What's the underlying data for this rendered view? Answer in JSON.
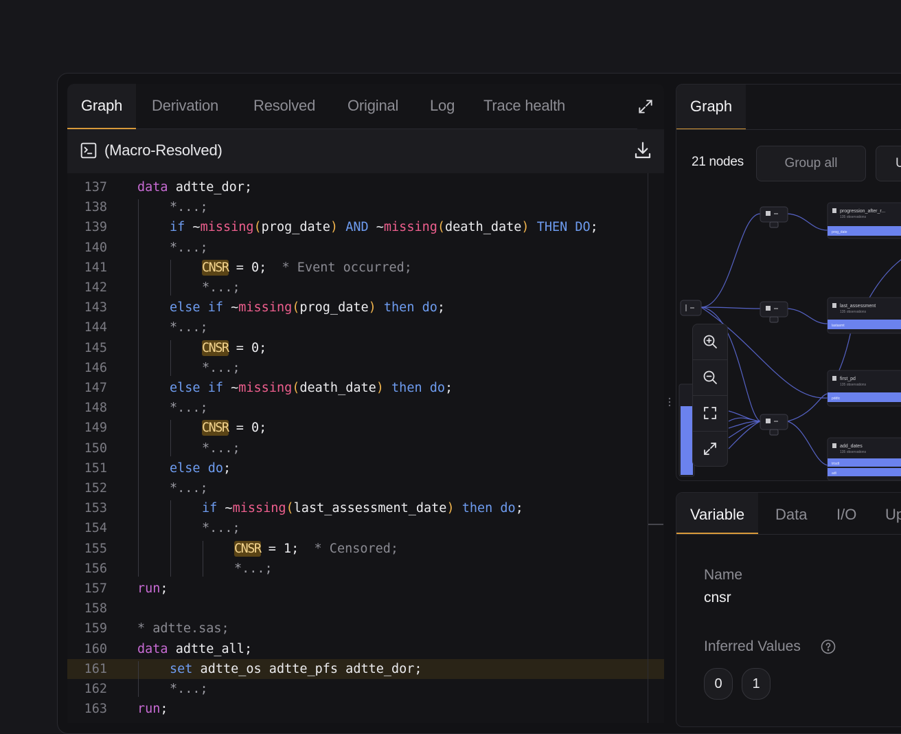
{
  "left_tabs": {
    "items": [
      "Graph",
      "Derivation",
      "Resolved",
      "Original",
      "Log",
      "Trace health"
    ],
    "active": "Graph"
  },
  "subheader": {
    "title": "(Macro-Resolved)"
  },
  "code": {
    "lines": [
      {
        "n": "137",
        "indent": 0,
        "html": "<span class=\"ds\">data</span> adtte_dor;"
      },
      {
        "n": "138",
        "indent": 1,
        "html": "<span class=\"ph\">*...;</span>"
      },
      {
        "n": "139",
        "indent": 1,
        "html": "<span class=\"kw\">if</span> ~<span class=\"fn\">missing</span><span class=\"pr\">(</span>prog_date<span class=\"pr\">)</span> <span class=\"kw\">AND</span> ~<span class=\"fn\">missing</span><span class=\"pr\">(</span>death_date<span class=\"pr\">)</span> <span class=\"kw\">THEN</span> <span class=\"kw\">DO</span>;"
      },
      {
        "n": "140",
        "indent": 1,
        "html": "<span class=\"ph\">*...;</span>"
      },
      {
        "n": "141",
        "indent": 2,
        "html": "<span class=\"var\">CNSR</span> = 0;  <span class=\"cm\">* Event occurred;</span>"
      },
      {
        "n": "142",
        "indent": 2,
        "html": "<span class=\"ph\">*...;</span>"
      },
      {
        "n": "143",
        "indent": 1,
        "html": "<span class=\"kw\">else</span> <span class=\"kw\">if</span> ~<span class=\"fn\">missing</span><span class=\"pr\">(</span>prog_date<span class=\"pr\">)</span> <span class=\"kw\">then</span> <span class=\"kw\">do</span>;"
      },
      {
        "n": "144",
        "indent": 1,
        "html": "<span class=\"ph\">*...;</span>"
      },
      {
        "n": "145",
        "indent": 2,
        "html": "<span class=\"var\">CNSR</span> = 0;"
      },
      {
        "n": "146",
        "indent": 2,
        "html": "<span class=\"ph\">*...;</span>"
      },
      {
        "n": "147",
        "indent": 1,
        "html": "<span class=\"kw\">else</span> <span class=\"kw\">if</span> ~<span class=\"fn\">missing</span><span class=\"pr\">(</span>death_date<span class=\"pr\">)</span> <span class=\"kw\">then</span> <span class=\"kw\">do</span>;"
      },
      {
        "n": "148",
        "indent": 1,
        "html": "<span class=\"ph\">*...;</span>"
      },
      {
        "n": "149",
        "indent": 2,
        "html": "<span class=\"var\">CNSR</span> = 0;"
      },
      {
        "n": "150",
        "indent": 2,
        "html": "<span class=\"ph\">*...;</span>"
      },
      {
        "n": "151",
        "indent": 1,
        "html": "<span class=\"kw\">else</span> <span class=\"kw\">do</span>;"
      },
      {
        "n": "152",
        "indent": 1,
        "html": "<span class=\"ph\">*...;</span>"
      },
      {
        "n": "153",
        "indent": 2,
        "html": "<span class=\"kw\">if</span> ~<span class=\"fn\">missing</span><span class=\"pr\">(</span>last_assessment_date<span class=\"pr\">)</span> <span class=\"kw\">then</span> <span class=\"kw\">do</span>;"
      },
      {
        "n": "154",
        "indent": 2,
        "html": "<span class=\"ph\">*...;</span>"
      },
      {
        "n": "155",
        "indent": 3,
        "html": "<span class=\"var\">CNSR</span> = 1;  <span class=\"cm\">* Censored;</span>"
      },
      {
        "n": "156",
        "indent": 3,
        "html": "<span class=\"ph\">*...;</span>"
      },
      {
        "n": "157",
        "indent": 0,
        "html": "<span class=\"ds\">run</span>;"
      },
      {
        "n": "158",
        "indent": 0,
        "html": ""
      },
      {
        "n": "159",
        "indent": 0,
        "html": "<span class=\"cm\">* adtte.sas;</span>"
      },
      {
        "n": "160",
        "indent": 0,
        "html": "<span class=\"ds\">data</span> adtte_all;"
      },
      {
        "n": "161",
        "indent": 1,
        "html": "<span class=\"kw\">set</span> adtte_os adtte_pfs adtte_dor;",
        "highlight": true
      },
      {
        "n": "162",
        "indent": 1,
        "html": "<span class=\"ph\">*...;</span>"
      },
      {
        "n": "163",
        "indent": 0,
        "html": "<span class=\"ds\">run</span>;"
      }
    ]
  },
  "graph_panel": {
    "tab": "Graph",
    "nodes_count": "21 nodes",
    "group_all_label": "Group all",
    "next_button_label": "U",
    "node_labels": [
      "progression_after_r...",
      "last_assessment",
      "first_pd",
      "add_dates"
    ],
    "node_sublabel": "135 observations",
    "row_labels": [
      "prog_date",
      "lastasmt",
      "pddtc",
      "trtsdt",
      "adt"
    ]
  },
  "variable_panel": {
    "tabs": [
      "Variable",
      "Data",
      "I/O",
      "Up"
    ],
    "active": "Variable",
    "name_label": "Name",
    "name_value": "cnsr",
    "inferred_label": "Inferred Values",
    "values": [
      "0",
      "1"
    ]
  },
  "colors": {
    "accent": "#d89a3a",
    "keyword": "#6e9cf0",
    "dataset_keyword": "#c86bd4",
    "function": "#ef5f8e",
    "paren": "#f0b34c",
    "graph_edge": "#5d6bd8",
    "graph_row": "#6b82ee"
  }
}
